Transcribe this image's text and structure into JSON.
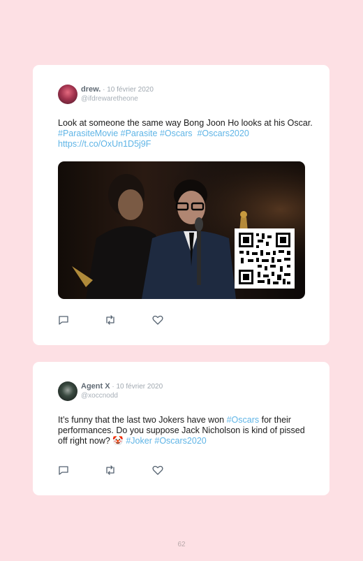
{
  "tweets": [
    {
      "author": "drew.",
      "separator": " · ",
      "date": "10 février 2020",
      "handle": "@ifdrewaretheone",
      "text_plain": "Look at someone the same way Bong Joon Ho looks at his Oscar. ",
      "tags": [
        "#ParasiteMovie",
        "#Parasite",
        "#Oscars",
        "#Oscars2020"
      ],
      "link": "https://t.co/OxUn1D5j9F",
      "media": "photo-with-qr-code"
    },
    {
      "author": "Agent X",
      "separator": " · ",
      "date": "10 février 2020",
      "handle": "@xoccnodd",
      "text_a": "It’s funny that the last two Jokers have won ",
      "tag_a": "#Oscars",
      "text_b": " for their performances. Do you suppose Jack Nicholson is kind of pissed off right now? ",
      "emoji": "🤡",
      "tag_b": "#Joker",
      "tag_c": "#Oscars2020"
    }
  ],
  "icons": [
    "reply-icon",
    "retweet-icon",
    "like-icon"
  ],
  "colors": {
    "background": "#fde0e4",
    "link": "#5eb4e6",
    "card": "#ffffff"
  },
  "page_number": "62"
}
